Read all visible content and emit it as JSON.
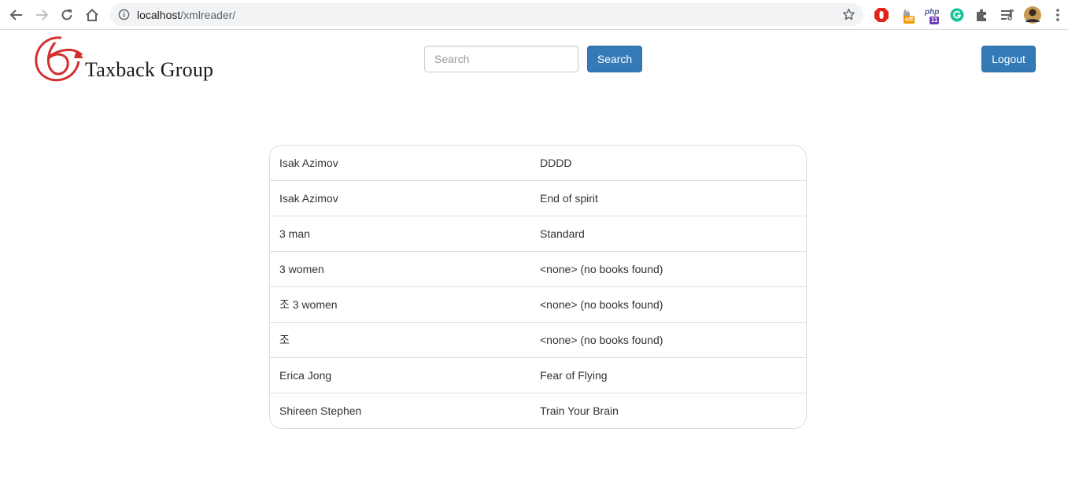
{
  "browser": {
    "url_host": "localhost",
    "url_path": "/xmlreader/",
    "extensions": [
      {
        "name": "adblock-icon",
        "color": "#e1251b"
      },
      {
        "name": "off-extension-icon",
        "badge": "off",
        "color": "#f29900"
      },
      {
        "name": "php-extension-icon",
        "label": "php",
        "badge": "11",
        "color": "#6a3eb5"
      },
      {
        "name": "grammarly-icon",
        "color": "#15c39a"
      },
      {
        "name": "puzzle-icon",
        "color": "#5f6368"
      },
      {
        "name": "media-queue-icon",
        "color": "#5f6368"
      }
    ]
  },
  "header": {
    "brand": "Taxback Group",
    "brand_color": "#d32f2f",
    "search_placeholder": "Search",
    "search_value": "",
    "search_button": "Search",
    "logout_button": "Logout",
    "accent": "#337ab7"
  },
  "books": [
    {
      "author": "Isak Azimov",
      "title": "DDDD"
    },
    {
      "author": "Isak Azimov",
      "title": "End of spirit"
    },
    {
      "author": "3 man",
      "title": "Standard"
    },
    {
      "author": "3 women",
      "title": "<none> (no books found)"
    },
    {
      "author": "조 3 women",
      "title": "<none> (no books found)"
    },
    {
      "author": "조",
      "title": "<none> (no books found)"
    },
    {
      "author": "Erica Jong",
      "title": "Fear of Flying"
    },
    {
      "author": "Shireen Stephen",
      "title": "Train Your Brain"
    }
  ]
}
